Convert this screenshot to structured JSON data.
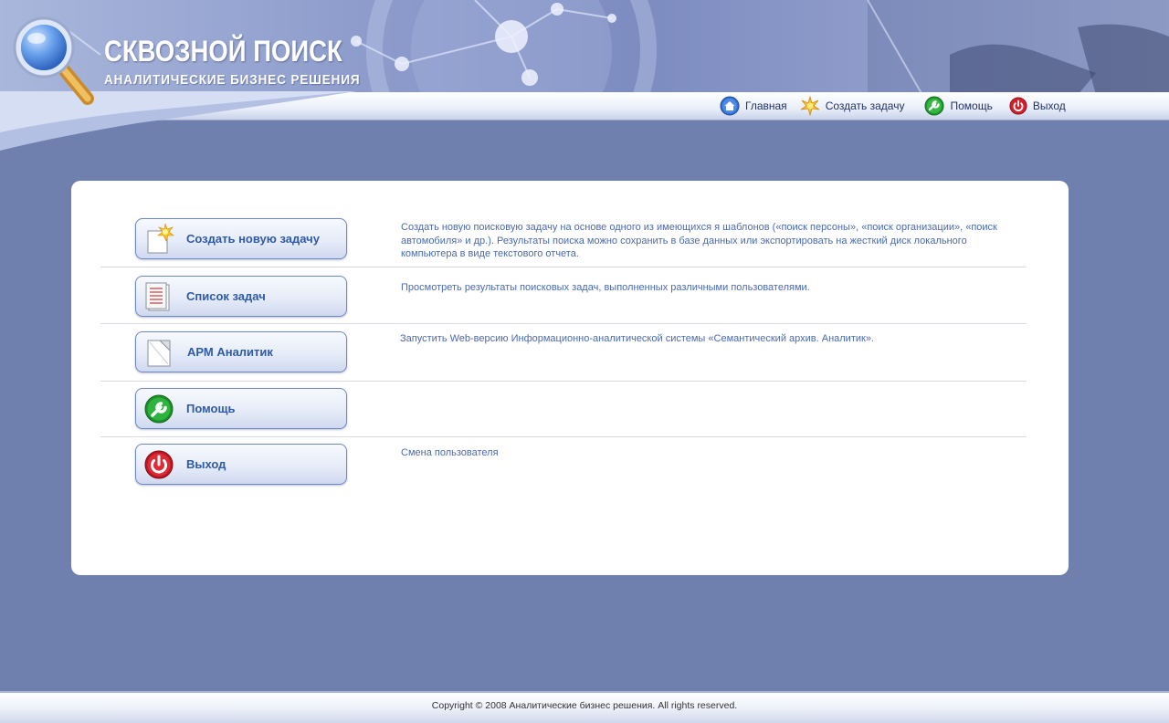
{
  "brand": {
    "title": "СКВОЗНОЙ ПОИСК",
    "subtitle": "АНАЛИТИЧЕСКИЕ БИЗНЕС РЕШЕНИЯ"
  },
  "topnav": {
    "home": "Главная",
    "create": "Создать задачу",
    "help": "Помощь",
    "exit": "Выход"
  },
  "menu": [
    {
      "label": "Создать новую задачу",
      "icon": "new-task-icon",
      "description": "Создать новую поисковую задачу на основе одного из имеющихся я шаблонов («поиск персоны», «поиск организации», «поиск автомобиля» и др.).  Результаты поиска можно сохранить в базе данных или экспортировать на жесткий диск локального компьютера в виде текстового отчета."
    },
    {
      "label": "Список задач",
      "icon": "task-list-icon",
      "description": "Просмотреть результаты поисковых задач, выполненных различными пользователями."
    },
    {
      "label": "АРМ Аналитик",
      "icon": "document-icon",
      "description": "Запустить Web-версию Информационно-аналитической системы «Семантический архив. Аналитик»."
    },
    {
      "label": "Помощь",
      "icon": "wrench-icon",
      "description": ""
    },
    {
      "label": "Выход",
      "icon": "power-icon",
      "description": "Смена пользователя"
    }
  ],
  "footer": {
    "copyright": "Copyright © 2008 Аналитические бизнес решения.  All rights reserved."
  },
  "colors": {
    "page_bg": "#6f7fae",
    "accent_text": "#2e5aa8",
    "desc_text": "#4a6ab0"
  }
}
